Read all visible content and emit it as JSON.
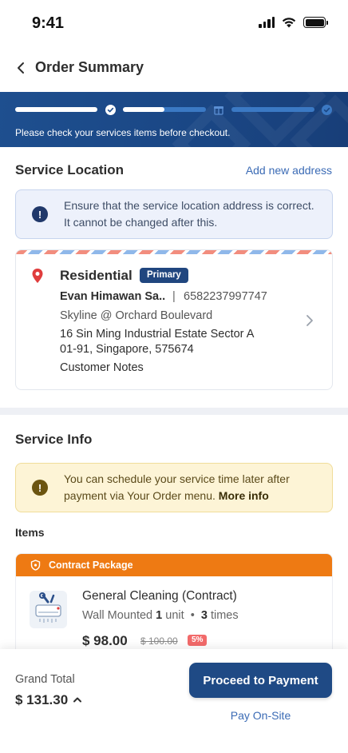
{
  "status_bar": {
    "time": "9:41"
  },
  "header": {
    "title": "Order Summary"
  },
  "banner": {
    "message": "Please check your services items before checkout."
  },
  "service_location": {
    "title": "Service Location",
    "add_link": "Add new address",
    "alert": "Ensure that the service location address is correct. It cannot be changed after this.",
    "address": {
      "type": "Residential",
      "badge": "Primary",
      "name": "Evan Himawan Sa..",
      "separator": "|",
      "phone": "6582237997747",
      "building": "Skyline @ Orchard Boulevard",
      "street": "16 Sin Ming Industrial Estate Sector A",
      "unit": "01-91, Singapore, 575674",
      "notes": "Customer Notes"
    }
  },
  "service_info": {
    "title": "Service Info",
    "alert_text": "You can schedule your service time later after payment via Your Order menu.",
    "alert_link": "More info",
    "items_label": "Items",
    "item": {
      "package": "Contract Package",
      "name": "General Cleaning (Contract)",
      "type": "Wall Mounted",
      "units_count": "1",
      "units_label": "unit",
      "dot": "•",
      "times_count": "3",
      "times_label": "times",
      "price": "$ 98.00",
      "old_price": "$ 100.00",
      "discount": "5%"
    }
  },
  "footer": {
    "grand_total_label": "Grand Total",
    "grand_total_value": "$ 131.30",
    "pay_button": "Proceed to Payment",
    "pay_onsite": "Pay On-Site"
  },
  "colors": {
    "primary": "#1f4a85",
    "link": "#3b6bb5",
    "orange": "#ee7a13",
    "discount": "#f26a6a"
  }
}
